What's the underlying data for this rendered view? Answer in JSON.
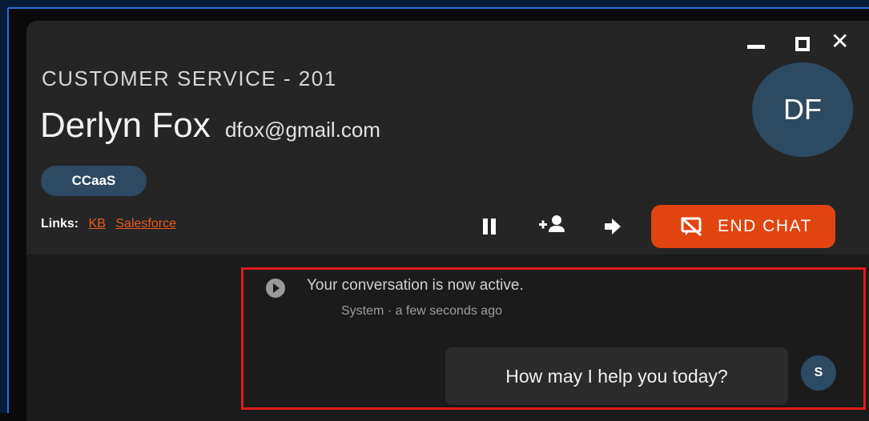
{
  "header": {
    "department": "CUSTOMER SERVICE - 201",
    "customer_name": "Derlyn Fox",
    "customer_email": "dfox@gmail.com",
    "avatar_initials": "DF",
    "tag": "CCaaS"
  },
  "window_controls": {
    "minimize_icon": "minimize-icon",
    "maximize_icon": "maximize-icon",
    "close_icon": "close-icon"
  },
  "links": {
    "label": "Links:",
    "items": [
      "KB",
      "Salesforce"
    ]
  },
  "toolbar": {
    "hold_icon": "pause-icon",
    "add_participant_icon": "add-person-icon",
    "transfer_icon": "arrow-right-icon",
    "end_chat_label": "END CHAT"
  },
  "conversation": {
    "system_message": "Your conversation is now active.",
    "system_meta": "System · a few seconds ago",
    "agent_message": "How may I help you today?",
    "agent_avatar": "S"
  },
  "colors": {
    "accent": "#e2440f",
    "avatar_bg": "#2d4a63",
    "link": "#e95a1c",
    "highlight": "#e21b1b"
  }
}
